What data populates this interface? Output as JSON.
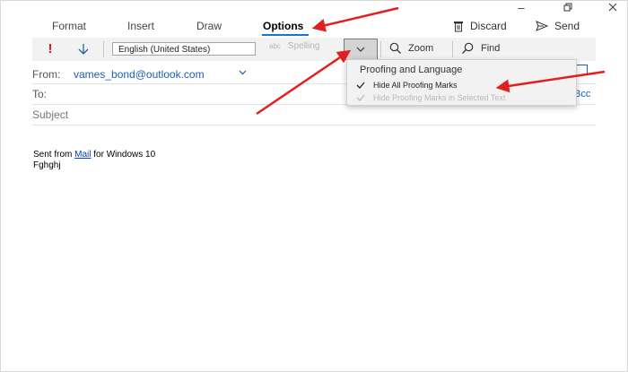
{
  "tabs": [
    {
      "label": "Format"
    },
    {
      "label": "Insert"
    },
    {
      "label": "Draw"
    },
    {
      "label": "Options"
    }
  ],
  "commands": {
    "discard": "Discard",
    "send": "Send"
  },
  "toolbar": {
    "language": "English (United States)",
    "spelling_label": "Spelling",
    "spelling_icon_text": "abc",
    "zoom_label": "Zoom",
    "find_label": "Find"
  },
  "header": {
    "from_label": "From:",
    "from_email": "vames_bond@outlook.com",
    "to_label": "To:",
    "bcc_label": "Bcc",
    "subject_label": "Subject"
  },
  "body": {
    "sent_prefix": "Sent from ",
    "mail_link": "Mail",
    "sent_suffix": " for Windows 10",
    "line2": "Fghghj"
  },
  "dropdown": {
    "title": "Proofing and Language",
    "item1": "Hide All Proofing Marks",
    "item2": "Hide Proofing Marks in Selected Text"
  },
  "colors": {
    "accent": "#1a73d9",
    "link": "#1a5fb4",
    "annotation_arrow": "#e02020"
  }
}
